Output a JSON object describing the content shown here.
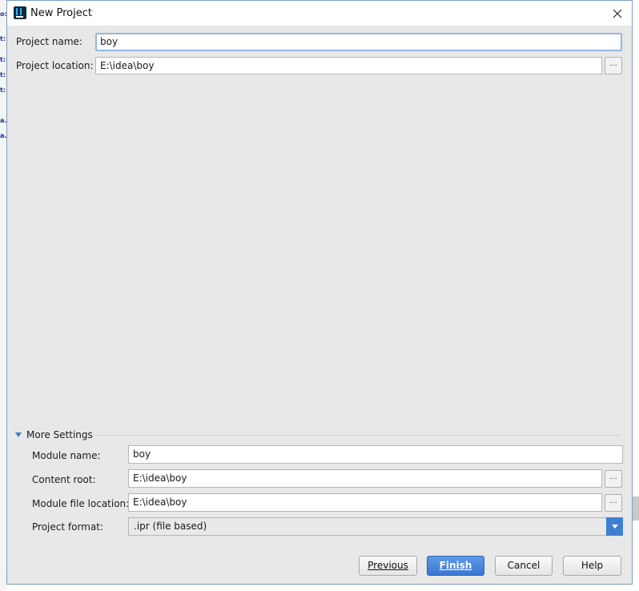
{
  "window": {
    "title": "New Project"
  },
  "project": {
    "name_label": "Project name:",
    "name_value": "boy",
    "location_label": "Project location:",
    "location_value": "E:\\idea\\boy"
  },
  "more_settings": {
    "label": "More Settings",
    "module_name_label": "Module name:",
    "module_name_value": "boy",
    "content_root_label": "Content root:",
    "content_root_value": "E:\\idea\\boy",
    "module_file_label": "Module file location:",
    "module_file_value": "E:\\idea\\boy",
    "format_label": "Project format:",
    "format_value": ".ipr (file based)"
  },
  "browse_label": "...",
  "buttons": {
    "previous": "Previous",
    "finish": "Finish",
    "cancel": "Cancel",
    "help": "Help"
  },
  "background_fragments": [
    "o:",
    "t:",
    "t:",
    "t:",
    "t:",
    "a.",
    "a."
  ],
  "colors": {
    "accent": "#3f7fd1",
    "primary_button": "#4a86dc",
    "dialog_bg": "#e8e8e8"
  },
  "icons": [
    "intellij-app-icon",
    "close-icon",
    "disclosure-triangle-icon",
    "dropdown-arrow-icon"
  ]
}
